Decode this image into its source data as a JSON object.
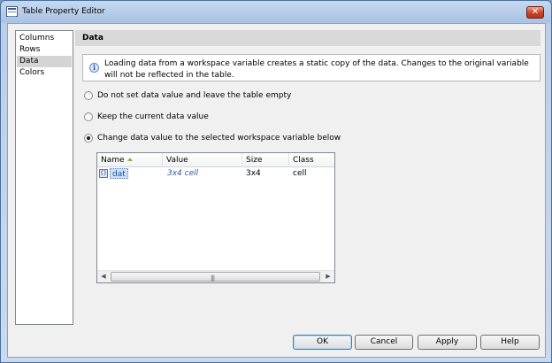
{
  "window": {
    "title": "Table Property Editor",
    "close_glyph": "✕"
  },
  "nav": {
    "items": [
      "Columns",
      "Rows",
      "Data",
      "Colors"
    ],
    "selected": "Data"
  },
  "section": {
    "title": "Data"
  },
  "info": {
    "icon": "info-icon",
    "text": "Loading data from a workspace variable creates a static copy of the data. Changes to the original variable will not be reflected in the table."
  },
  "options": [
    {
      "label": "Do not set data value and leave the table empty",
      "checked": false
    },
    {
      "label": "Keep the current data value",
      "checked": false
    },
    {
      "label": "Change data value to the selected workspace variable below",
      "checked": true
    }
  ],
  "variables": {
    "columns": [
      "Name",
      "Value",
      "Size",
      "Class"
    ],
    "rows": [
      {
        "name": "dat",
        "value": "3x4 cell",
        "size": "3x4",
        "class": "cell"
      }
    ],
    "sort_column": "Name"
  },
  "buttons": {
    "ok": "OK",
    "cancel": "Cancel",
    "apply": "Apply",
    "help": "Help"
  },
  "colors": {
    "accent": "#3c7fb1",
    "selection": "#cfe1fa",
    "close": "#c7472b"
  }
}
